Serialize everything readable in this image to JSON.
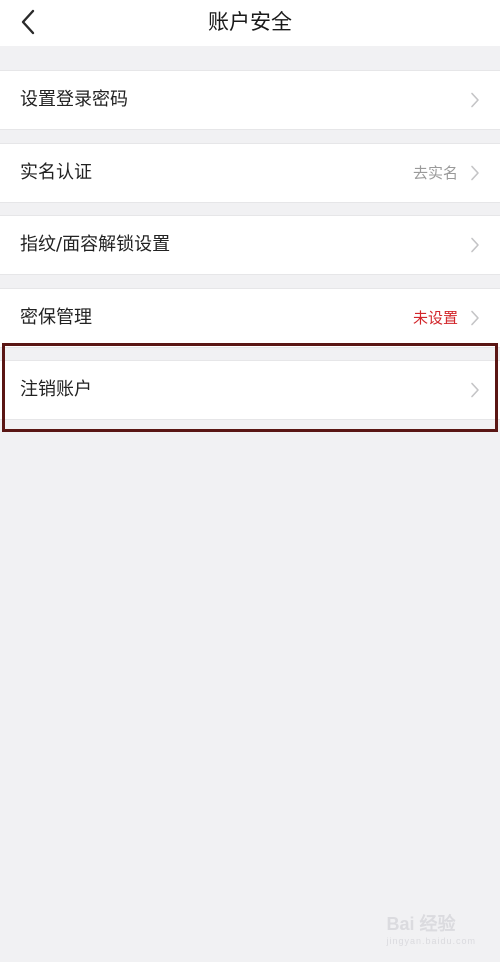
{
  "header": {
    "title": "账户安全",
    "back_icon": "chevron-left-icon"
  },
  "settings": [
    {
      "label": "设置登录密码",
      "value": "",
      "status": "none"
    },
    {
      "label": "实名认证",
      "value": "去实名",
      "status": "muted"
    },
    {
      "label": "指纹/面容解锁设置",
      "value": "",
      "status": "none"
    },
    {
      "label": "密保管理",
      "value": "未设置",
      "status": "alert"
    },
    {
      "label": "注销账户",
      "value": "",
      "status": "none",
      "highlighted": true
    }
  ],
  "colors": {
    "background": "#f1f1f3",
    "row_background": "#ffffff",
    "alert": "#d2262b",
    "muted": "#9a9a9a",
    "highlight_border": "#5a1614"
  },
  "watermark": {
    "text": "Bai 经验",
    "sub": "jingyan.baidu.com"
  }
}
